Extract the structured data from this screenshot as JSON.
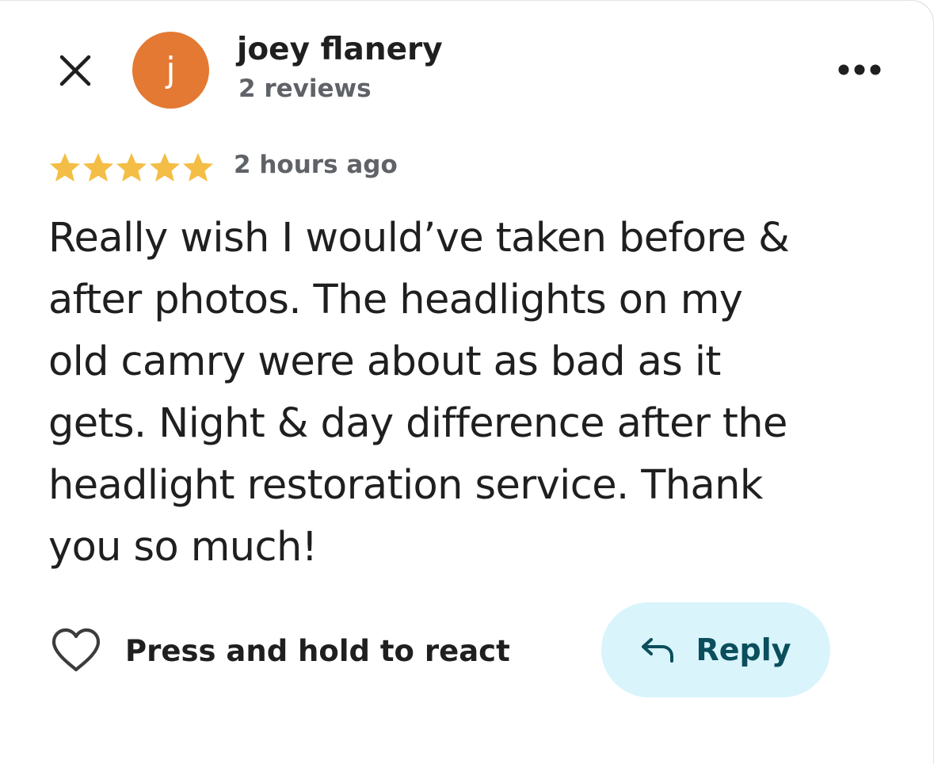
{
  "review": {
    "author": {
      "name": "joey flanery",
      "review_count": "2 reviews",
      "avatar_initial": "j",
      "avatar_color": "#e37933"
    },
    "rating": 5,
    "max_rating": 5,
    "time_ago": "2 hours ago",
    "body": "Really wish I would’ve taken before &\nafter photos. The headlights on my\nold camry were about as bad as it\ngets. Night & day difference after the\nheadlight restoration service. Thank\nyou so much!"
  },
  "actions": {
    "react_label": "Press and hold to react",
    "reply_label": "Reply"
  },
  "icons": {
    "close": "close-icon",
    "more": "more-options-icon",
    "star": "star-icon",
    "heart": "heart-outline-icon",
    "reply": "reply-arrow-icon"
  },
  "colors": {
    "star": "#f4be46",
    "reply_bg": "#d9f4fb",
    "reply_text": "#0b4e5c",
    "secondary_text": "#5f6368"
  }
}
